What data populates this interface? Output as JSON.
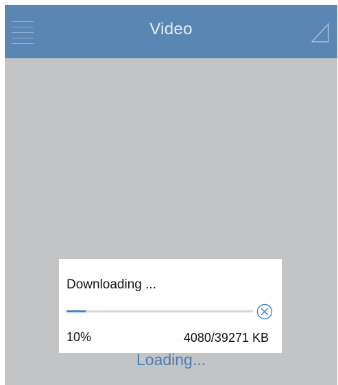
{
  "navbar": {
    "title": "Video",
    "menu_icon": "hamburger-menu-icon",
    "right_icon": "signal-triangle-icon",
    "background_color": "#5a86b4"
  },
  "download_dialog": {
    "title": "Downloading ...",
    "progress_fraction": 0.104,
    "percent_label": "10%",
    "size_label": "4080/39271 KB",
    "cancel_icon": "cancel-circle-x-icon",
    "progress_color": "#3b82d6"
  },
  "status": {
    "loading_label": "Loading..."
  },
  "colors": {
    "content_background": "#c3c4c5",
    "loading_text": "#4a7db4"
  }
}
